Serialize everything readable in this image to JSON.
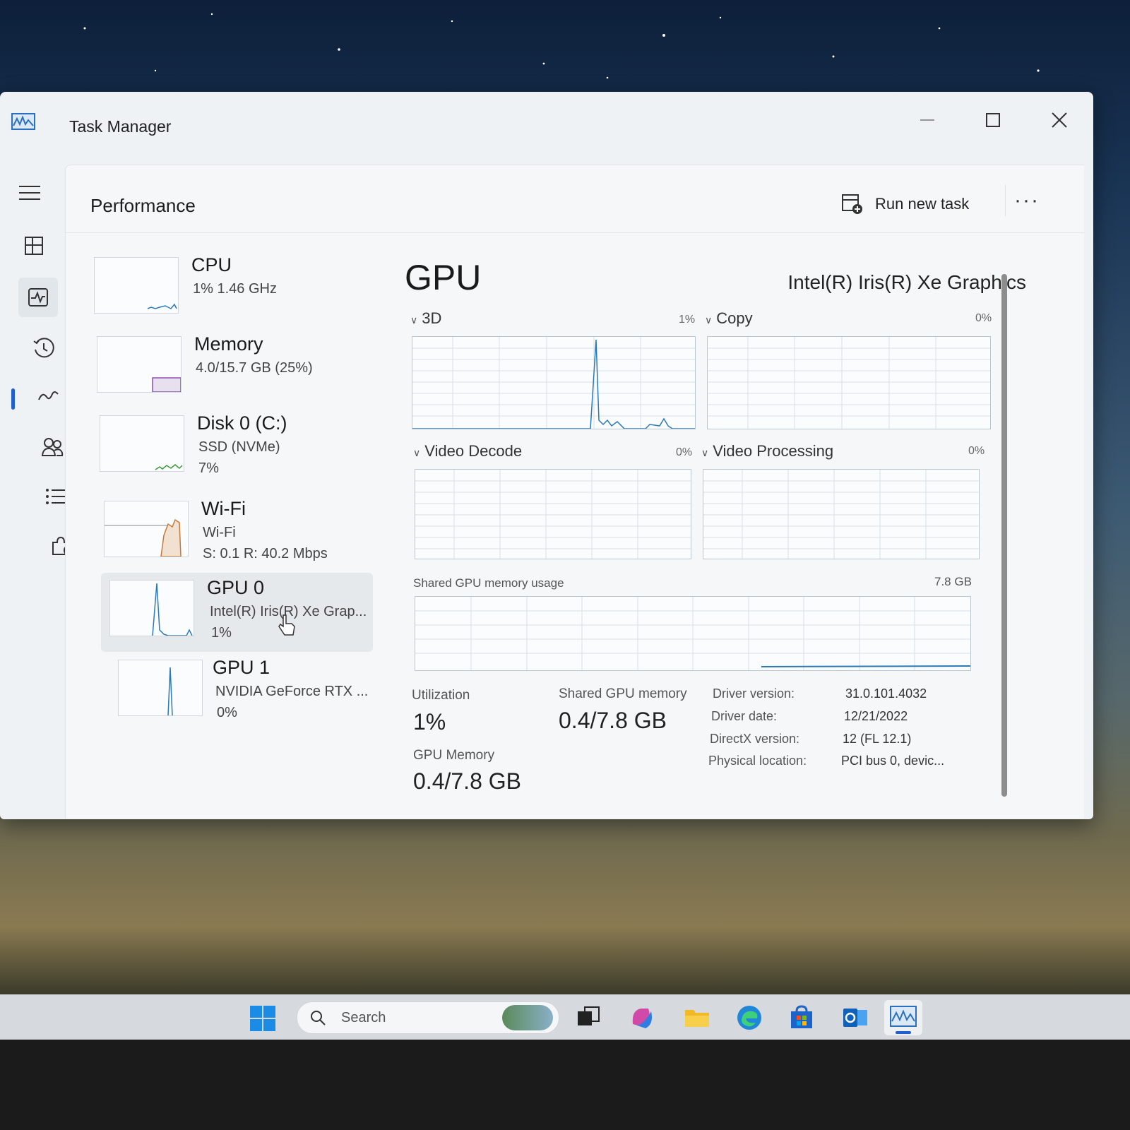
{
  "window": {
    "title": "Task Manager"
  },
  "header": {
    "page_title": "Performance",
    "run_new_task": "Run new task",
    "more": "···"
  },
  "resources": [
    {
      "name": "CPU",
      "line1": "1%  1.46 GHz",
      "line2": ""
    },
    {
      "name": "Memory",
      "line1": "4.0/15.7 GB (25%)",
      "line2": ""
    },
    {
      "name": "Disk 0 (C:)",
      "line1": "SSD (NVMe)",
      "line2": "7%"
    },
    {
      "name": "Wi-Fi",
      "line1": "Wi-Fi",
      "line2": "S: 0.1  R: 40.2 Mbps"
    },
    {
      "name": "GPU 0",
      "line1": "Intel(R) Iris(R) Xe Grap...",
      "line2": "1%"
    },
    {
      "name": "GPU 1",
      "line1": "NVIDIA GeForce RTX ...",
      "line2": "0%"
    }
  ],
  "detail": {
    "title": "GPU",
    "model": "Intel(R) Iris(R) Xe Graphics",
    "engines": [
      {
        "label": "3D",
        "pct": "1%"
      },
      {
        "label": "Copy",
        "pct": "0%"
      },
      {
        "label": "Video Decode",
        "pct": "0%"
      },
      {
        "label": "Video Processing",
        "pct": "0%"
      }
    ],
    "shared_label": "Shared GPU memory usage",
    "shared_max": "7.8 GB",
    "stats": {
      "utilization_label": "Utilization",
      "utilization_value": "1%",
      "shared_mem_label": "Shared GPU memory",
      "shared_mem_value": "0.4/7.8 GB",
      "gpu_mem_label": "GPU Memory",
      "gpu_mem_value": "0.4/7.8 GB"
    },
    "info": [
      {
        "key": "Driver version:",
        "value": "31.0.101.4032"
      },
      {
        "key": "Driver date:",
        "value": "12/21/2022"
      },
      {
        "key": "DirectX version:",
        "value": "12 (FL 12.1)"
      },
      {
        "key": "Physical location:",
        "value": "PCI bus 0, devic..."
      }
    ]
  },
  "taskbar": {
    "search_placeholder": "Search"
  },
  "colors": {
    "accent": "#1f5fd0",
    "gpu_line": "#2a7ab8",
    "net_line": "#c27b3a",
    "disk_line": "#3c9a3c",
    "mem_line": "#8a4fb3"
  }
}
